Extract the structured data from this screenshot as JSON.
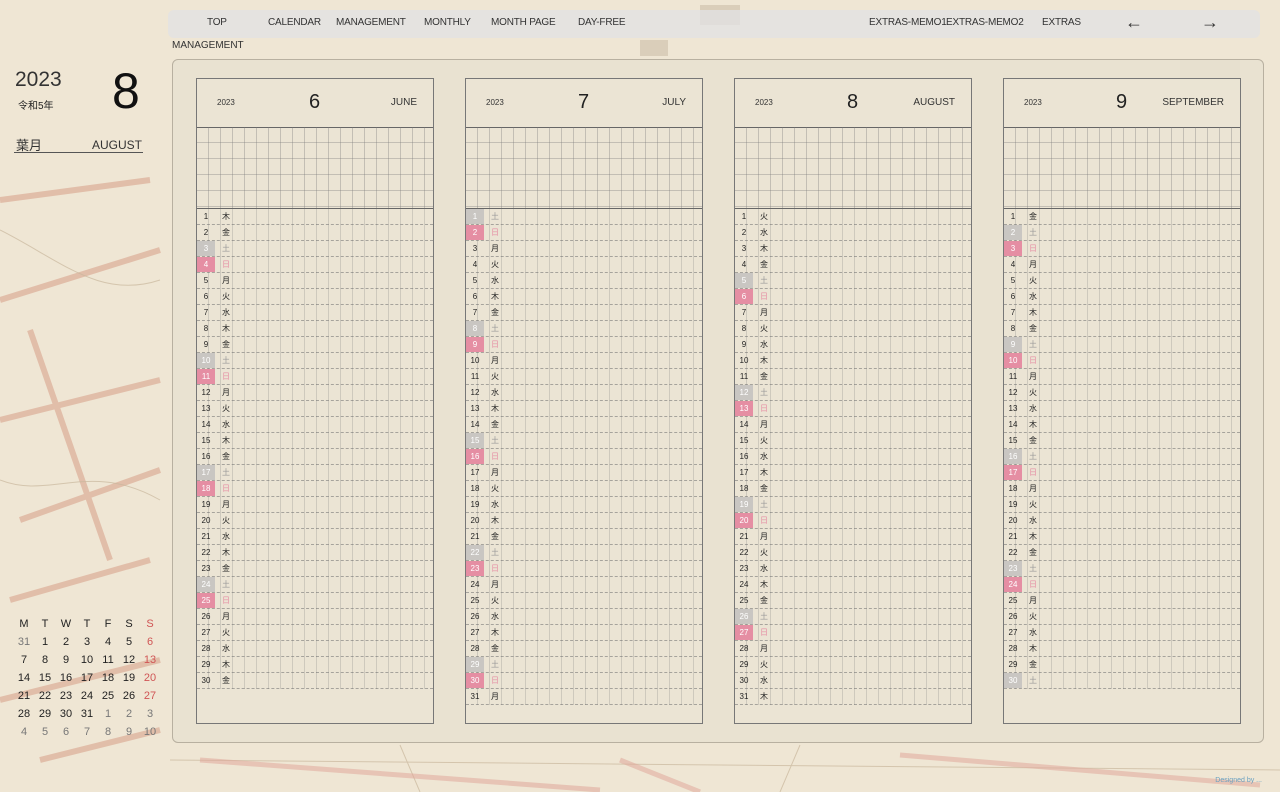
{
  "nav": {
    "items": [
      "TOP",
      "CALENDAR",
      "MANAGEMENT",
      "MONTHLY",
      "MONTH PAGE",
      "DAY-FREE",
      "EXTRAS-MEMO1",
      "EXTRAS-MEMO2",
      "EXTRAS"
    ],
    "prev_arrow": "←",
    "next_arrow": "→"
  },
  "page_label": "MANAGEMENT",
  "left_panel": {
    "year": "2023",
    "era": "令和5年",
    "month_number": "8",
    "japanese_month": "葉月",
    "english_month": "AUGUST"
  },
  "mini_calendar": {
    "weekdays": [
      "M",
      "T",
      "W",
      "T",
      "F",
      "S",
      "S"
    ],
    "weeks": [
      [
        "31",
        "1",
        "2",
        "3",
        "4",
        "5",
        "6"
      ],
      [
        "7",
        "8",
        "9",
        "10",
        "11",
        "12",
        "13"
      ],
      [
        "14",
        "15",
        "16",
        "17",
        "18",
        "19",
        "20"
      ],
      [
        "21",
        "22",
        "23",
        "24",
        "25",
        "26",
        "27"
      ],
      [
        "28",
        "29",
        "30",
        "31",
        "1",
        "2",
        "3"
      ],
      [
        "4",
        "5",
        "6",
        "7",
        "8",
        "9",
        "10"
      ]
    ]
  },
  "months": [
    {
      "year": "2023",
      "number": "6",
      "name": "JUNE",
      "start_weekday_index": 3,
      "days": 30
    },
    {
      "year": "2023",
      "number": "7",
      "name": "JULY",
      "start_weekday_index": 5,
      "days": 31
    },
    {
      "year": "2023",
      "number": "8",
      "name": "AUGUST",
      "start_weekday_index": 1,
      "days": 31
    },
    {
      "year": "2023",
      "number": "9",
      "name": "SEPTEMBER",
      "start_weekday_index": 4,
      "days": 30
    }
  ],
  "weekday_kanji": [
    "月",
    "火",
    "水",
    "木",
    "金",
    "土",
    "日"
  ],
  "colors": {
    "saturday_badge": "#c9c6c2",
    "sunday_badge": "#e58ea3",
    "panel_bg": "#e8e2d0"
  },
  "credit": "Designed by ..."
}
